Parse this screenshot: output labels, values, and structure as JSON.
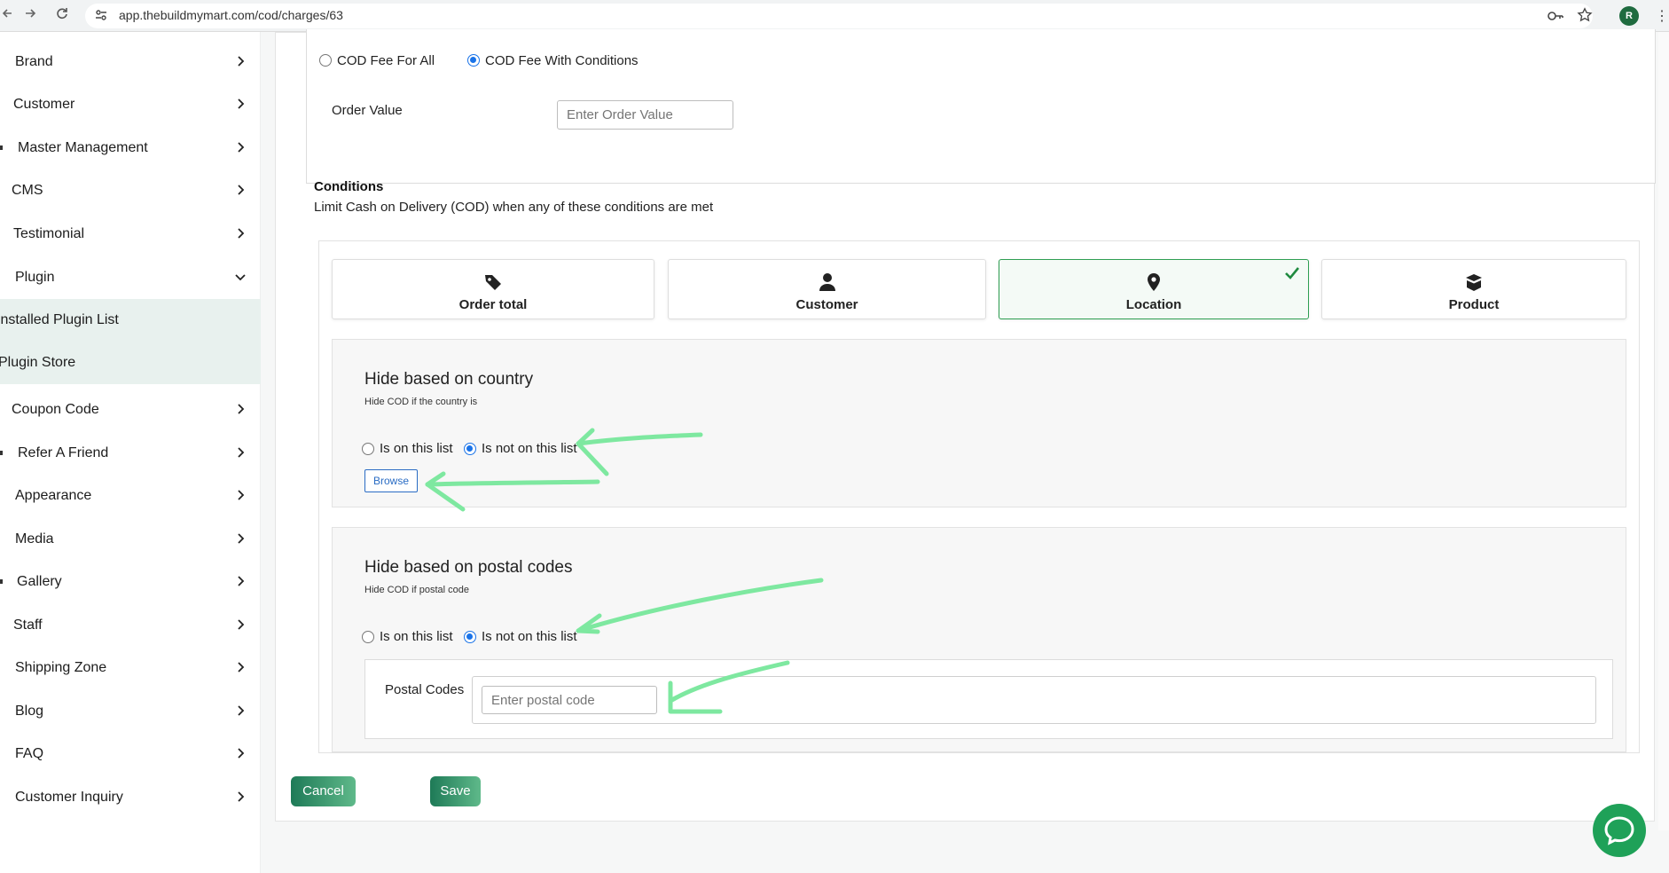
{
  "browser": {
    "url": "app.thebuildmymart.com/cod/charges/63",
    "profile_initial": "R"
  },
  "sidebar": {
    "items": [
      {
        "label": "Brand"
      },
      {
        "label": "Customer"
      },
      {
        "label": "Master Management"
      },
      {
        "label": "CMS"
      },
      {
        "label": "Testimonial"
      },
      {
        "label": "Plugin"
      },
      {
        "label": "Installed Plugin List"
      },
      {
        "label": "Plugin Store"
      },
      {
        "label": "Coupon Code"
      },
      {
        "label": "Refer A Friend"
      },
      {
        "label": "Appearance"
      },
      {
        "label": "Media"
      },
      {
        "label": "Gallery"
      },
      {
        "label": "Staff"
      },
      {
        "label": "Shipping Zone"
      },
      {
        "label": "Blog"
      },
      {
        "label": "FAQ"
      },
      {
        "label": "Customer Inquiry"
      }
    ]
  },
  "fee_mode": {
    "option_all": "COD Fee For All",
    "option_conditions": "COD Fee With Conditions",
    "selected": "COD Fee With Conditions"
  },
  "order_value": {
    "label": "Order Value",
    "placeholder": "Enter Order Value"
  },
  "conditions": {
    "title": "Conditions",
    "description": "Limit Cash on Delivery (COD) when any of these conditions are met",
    "tabs": [
      {
        "label": "Order total",
        "icon": "tag-icon"
      },
      {
        "label": "Customer",
        "icon": "user-icon"
      },
      {
        "label": "Location",
        "icon": "map-pin-icon",
        "active": true
      },
      {
        "label": "Product",
        "icon": "box-icon"
      }
    ]
  },
  "country_section": {
    "title": "Hide based on country",
    "subtitle": "Hide COD if the country is",
    "option_on": "Is on this list",
    "option_not_on": "Is not on this list",
    "selected": "Is not on this list",
    "browse_label": "Browse"
  },
  "postal_section": {
    "title": "Hide based on postal codes",
    "subtitle": "Hide COD if postal code",
    "option_on": "Is on this list",
    "option_not_on": "Is not on this list",
    "selected": "Is not on this list",
    "field_label": "Postal Codes",
    "placeholder": "Enter postal code"
  },
  "actions": {
    "cancel_label": "Cancel",
    "save_label": "Save"
  },
  "colors": {
    "accent_green": "#1e7a57",
    "selected_tab_border": "#2e9e52",
    "annotation_arrow": "#7ee8a0",
    "radio_blue": "#1a73e8"
  }
}
